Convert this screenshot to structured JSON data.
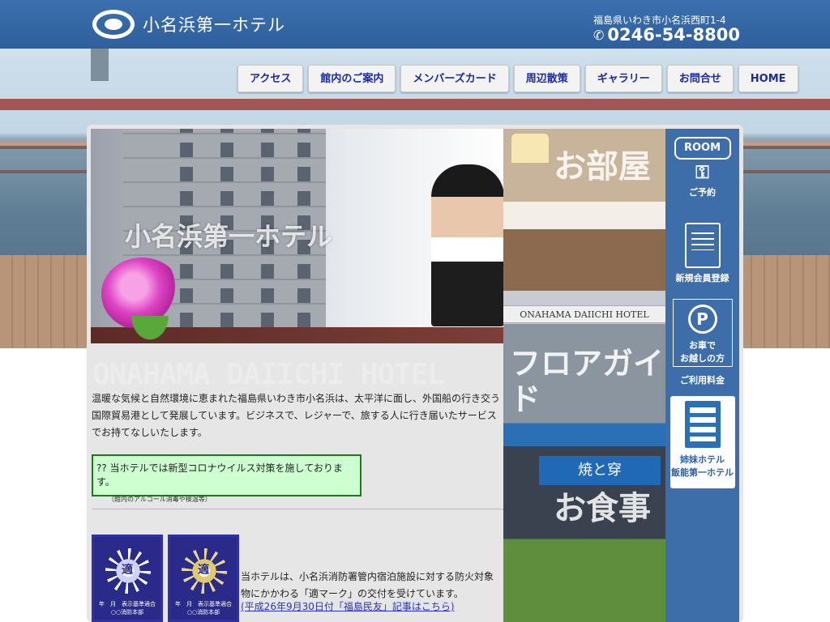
{
  "header": {
    "hotel_name": "小名浜第一ホテル",
    "address": "福島県いわき市小名浜西町1-4",
    "phone": "0246-54-8800"
  },
  "nav": [
    {
      "label": "アクセス"
    },
    {
      "label": "館内のご案内"
    },
    {
      "label": "メンバーズカード"
    },
    {
      "label": "周辺散策"
    },
    {
      "label": "ギャラリー"
    },
    {
      "label": "お問合せ"
    },
    {
      "label": "HOME"
    }
  ],
  "hero": {
    "caption": "小名浜第一ホテル"
  },
  "photos": {
    "room_label": "お部屋",
    "hotel_sign": "ONAHAMA DAIICHI HOTEL",
    "floor_label": "フロアガイド",
    "dining_sign": "焼と穿",
    "dining_label": "お食事"
  },
  "sidebar": {
    "room_badge": "ROOM",
    "reserve": "ご予約",
    "register": "新規会員登録",
    "car_line1": "お車で",
    "car_line2": "お越しの方",
    "usage_fee": "ご利用料金",
    "sister_line1": "姉妹ホテル",
    "sister_line2": "飯能第一ホテル"
  },
  "main": {
    "watermark": "ONAHAMA DAIICHI HOTEL",
    "intro": "温暖な気候と自然環境に恵まれた福島県いわき市小名浜は、太平洋に面し、外国船の行き交う国際貿易港として発展しています。ビジネスで、レジャーで、旅する人に行き届いたサービスでお持てなしいたします。",
    "notice_main": "?? 当ホテルでは新型コロナウイルス対策を施しております。",
    "notice_sub": "（館内のアルコール消毒や検温等）",
    "sticker_symbol": "適",
    "sticker_caption1": "年　月　表示基準適合",
    "sticker_caption2": "○○消防本部",
    "fire_text": "当ホテルは、小名浜消防署管内宿泊施設に対する防火対象物にかかわる「適マーク」の交付を受けています。",
    "fire_link": "(平成26年9月30日付「福島民友」記事はこちら)"
  },
  "colors": {
    "header_blue": "#2e5f9c",
    "sidebar_blue": "#3d6ea9",
    "nav_text": "#1b2aa6",
    "notice_bg": "#ceffd0",
    "link": "#2b32c9"
  }
}
